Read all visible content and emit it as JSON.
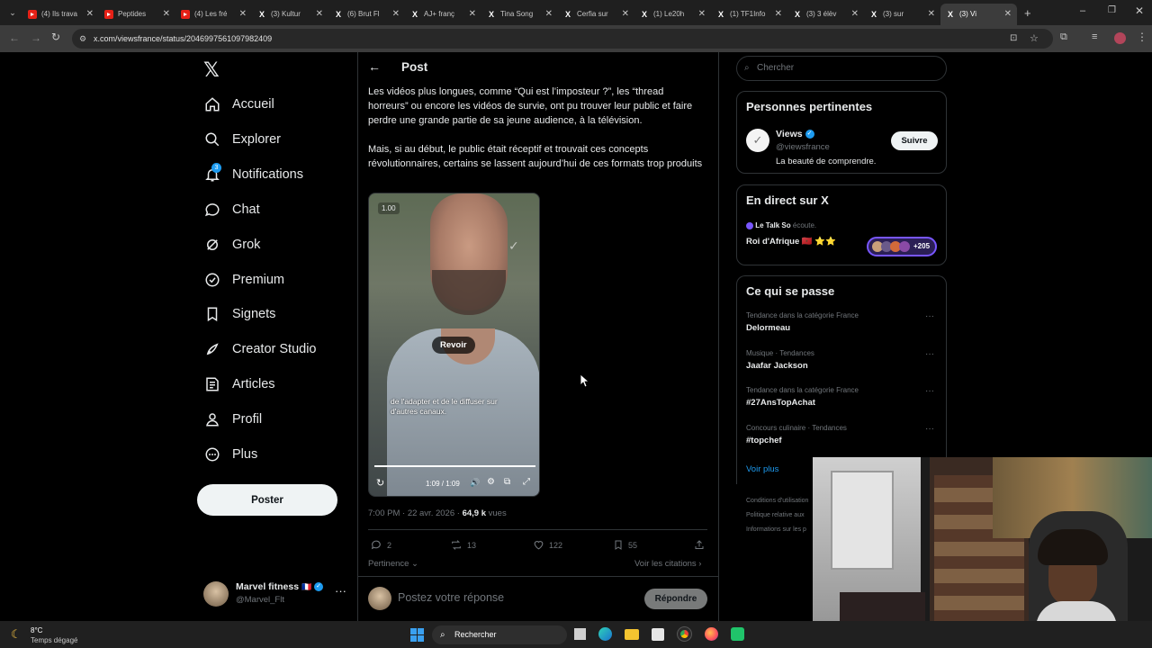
{
  "browser": {
    "tabs": [
      {
        "label": "(4) Ils trava",
        "icon": "youtube"
      },
      {
        "label": "Peptides",
        "icon": "youtube"
      },
      {
        "label": "(4) Les fré",
        "icon": "youtube"
      },
      {
        "label": "(3) Kultur",
        "icon": "x"
      },
      {
        "label": "(6) Brut Fl",
        "icon": "x"
      },
      {
        "label": "AJ+ franç",
        "icon": "x"
      },
      {
        "label": "Tina Song",
        "icon": "x"
      },
      {
        "label": "Cerfia sur",
        "icon": "x"
      },
      {
        "label": "(1) Le20h",
        "icon": "x"
      },
      {
        "label": "(1) TF1Info",
        "icon": "x"
      },
      {
        "label": "(3) 3 élèv",
        "icon": "x"
      },
      {
        "label": "(3) sur",
        "icon": "x"
      },
      {
        "label": "(3) Vi",
        "icon": "x"
      }
    ],
    "url": "x.com/viewsfrance/status/2046997561097982409"
  },
  "nav": {
    "items": [
      {
        "label": "Accueil",
        "icon": "home"
      },
      {
        "label": "Explorer",
        "icon": "search"
      },
      {
        "label": "Notifications",
        "icon": "bell",
        "badge": "3"
      },
      {
        "label": "Chat",
        "icon": "chat"
      },
      {
        "label": "Grok",
        "icon": "grok"
      },
      {
        "label": "Premium",
        "icon": "premium"
      },
      {
        "label": "Signets",
        "icon": "bookmark"
      },
      {
        "label": "Creator Studio",
        "icon": "rocket"
      },
      {
        "label": "Articles",
        "icon": "article"
      },
      {
        "label": "Profil",
        "icon": "person"
      },
      {
        "label": "Plus",
        "icon": "more"
      }
    ],
    "post_button": "Poster",
    "account": {
      "name": "Marvel fitness",
      "flag": "🇫🇷",
      "handle": "@Marvel_Flt"
    }
  },
  "post": {
    "header": "Post",
    "paragraph1": "Les vidéos plus longues, comme “Qui est l’imposteur ?”, les “thread horreurs” ou encore les vidéos de survie, ont pu trouver leur public et faire perdre une grande partie de sa jeune audience, à la télévision.",
    "paragraph2": "Mais, si au début, le public était réceptif et trouvait ces concepts révolutionnaires, certains se lassent aujourd’hui de ces formats trop produits",
    "video": {
      "speed": "1.00",
      "replay_label": "Revoir",
      "caption": "de l'adapter et de le diffuser sur d'autres canaux.",
      "time": "1:09 / 1:09",
      "progress": 1.0
    },
    "meta_time": "7:00 PM · 22 avr. 2026 · ",
    "meta_views": "64,9 k",
    "meta_views_label": " vues",
    "actions": {
      "replies": "2",
      "reposts": "13",
      "likes": "122",
      "bookmarks": "55"
    },
    "sort_label": "Pertinence",
    "quotes_link": "Voir les citations",
    "reply_placeholder": "Postez votre réponse",
    "reply_button": "Répondre"
  },
  "sidebar": {
    "search_placeholder": "Chercher",
    "relevant": {
      "title": "Personnes pertinentes",
      "name": "Views",
      "handle": "@viewsfrance",
      "bio": "La beauté de comprendre.",
      "follow": "Suivre"
    },
    "live": {
      "title": "En direct sur X",
      "host": "Le Talk So",
      "host_action": "écoute.",
      "space_title": "Roi d'Afrique 🇲🇦 ⭐⭐",
      "listeners": "+205"
    },
    "trending": {
      "title": "Ce qui se passe",
      "items": [
        {
          "context": "Tendance dans la catégorie France",
          "name": "Delormeau"
        },
        {
          "context": "Musique · Tendances",
          "name": "Jaafar Jackson"
        },
        {
          "context": "Tendance dans la catégorie France",
          "name": "#27AnsTopAchat"
        },
        {
          "context": "Concours culinaire · Tendances",
          "name": "#topchef"
        }
      ],
      "more": "Voir plus"
    },
    "footer": [
      "Conditions d'utilisation",
      "Politique relative aux",
      "Informations sur les p"
    ]
  },
  "taskbar": {
    "temp": "8°C",
    "weather": "Temps dégagé",
    "search": "Rechercher"
  },
  "colors": {
    "accent": "#1d9bf0",
    "bg": "#000000",
    "border": "#2f3336",
    "muted": "#71767b"
  }
}
